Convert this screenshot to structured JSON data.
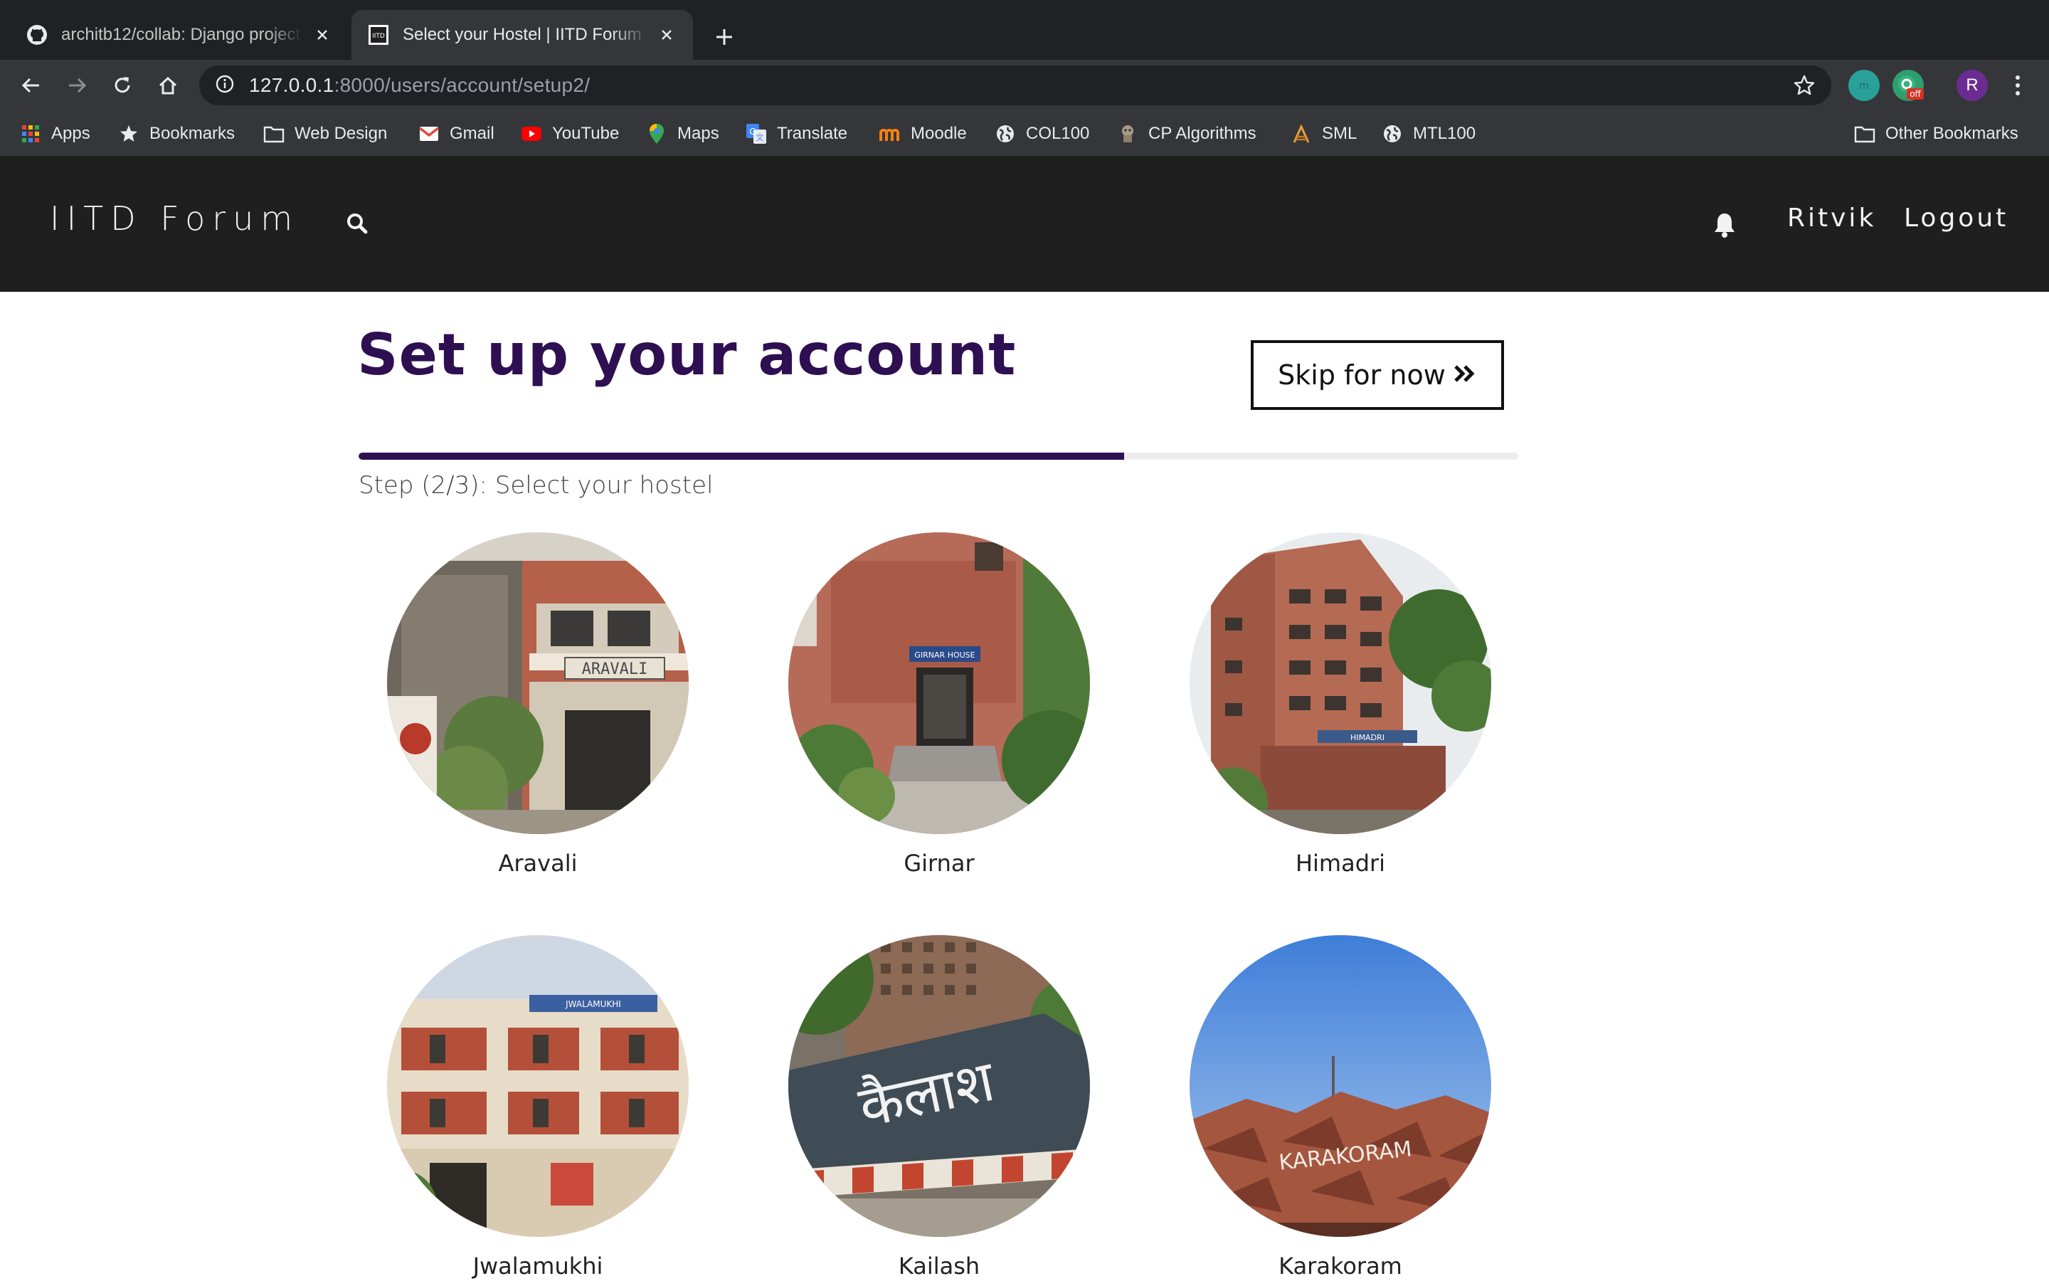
{
  "browser": {
    "tabs": [
      {
        "title": "architb12/collab: Django project",
        "active": false
      },
      {
        "title": "Select your Hostel | IITD Forum",
        "active": true
      }
    ],
    "url_host": "127.0.0.1",
    "url_path": ":8000/users/account/setup2/",
    "profile_initial": "R",
    "extension_badge": "off",
    "bookmarks": [
      {
        "label": "Apps",
        "icon": "apps-grid-icon"
      },
      {
        "label": "Bookmarks",
        "icon": "star-icon"
      },
      {
        "label": "Web Design",
        "icon": "folder-icon"
      },
      {
        "label": "Gmail",
        "icon": "gmail-icon"
      },
      {
        "label": "YouTube",
        "icon": "youtube-icon"
      },
      {
        "label": "Maps",
        "icon": "maps-pin-icon"
      },
      {
        "label": "Translate",
        "icon": "translate-icon"
      },
      {
        "label": "Moodle",
        "icon": "moodle-icon"
      },
      {
        "label": "COL100",
        "icon": "globe-icon"
      },
      {
        "label": "CP Algorithms",
        "icon": "cp-algorithms-icon"
      },
      {
        "label": "SML",
        "icon": "sml-icon"
      },
      {
        "label": "MTL100",
        "icon": "globe-icon"
      }
    ],
    "other_bookmarks": "Other Bookmarks"
  },
  "site": {
    "brand": "IITD Forum",
    "user": "Ritvik",
    "logout": "Logout"
  },
  "page": {
    "heading": "Set up your account",
    "skip_label": "Skip for now",
    "step_label": "Step (2/3): Select your hostel",
    "progress": 0.66
  },
  "hostels": [
    {
      "name": "Aravali",
      "sign": "ARAVALI"
    },
    {
      "name": "Girnar",
      "sign": "GIRNAR HOUSE"
    },
    {
      "name": "Himadri",
      "sign": "HIMADRI"
    },
    {
      "name": "Jwalamukhi",
      "sign": "JWALAMUKHI"
    },
    {
      "name": "Kailash",
      "sign": "कैलाश"
    },
    {
      "name": "Karakoram",
      "sign": "KARAKORAM"
    }
  ],
  "colors": {
    "accent": "#2e0f52",
    "nav_bg": "#1f1f1f",
    "chrome_bg": "#35363a"
  }
}
